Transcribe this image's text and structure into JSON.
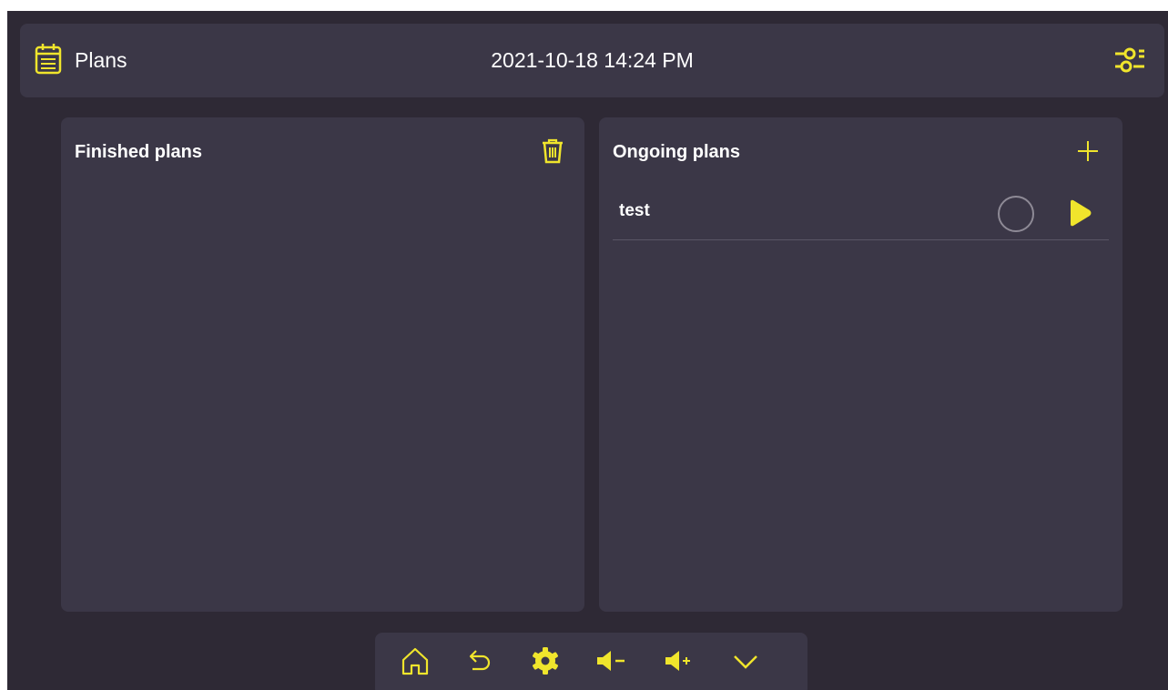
{
  "header": {
    "title": "Plans",
    "datetime": "2021-10-18 14:24 PM"
  },
  "panels": {
    "finished": {
      "title": "Finished plans"
    },
    "ongoing": {
      "title": "Ongoing plans",
      "items": [
        {
          "name": "test"
        }
      ]
    }
  },
  "colors": {
    "accent": "#f0e52c",
    "background": "#2e2935",
    "panel": "#3b3747",
    "text": "#ffffff"
  },
  "icons": {
    "header": [
      "calendar-icon",
      "settings-sliders-icon"
    ],
    "panels": [
      "trash-icon",
      "plus-icon",
      "status-circle-icon",
      "play-icon"
    ],
    "bottom_bar": [
      "home-icon",
      "back-icon",
      "gear-icon",
      "volume-down-icon",
      "volume-up-icon",
      "chevron-down-icon"
    ]
  }
}
